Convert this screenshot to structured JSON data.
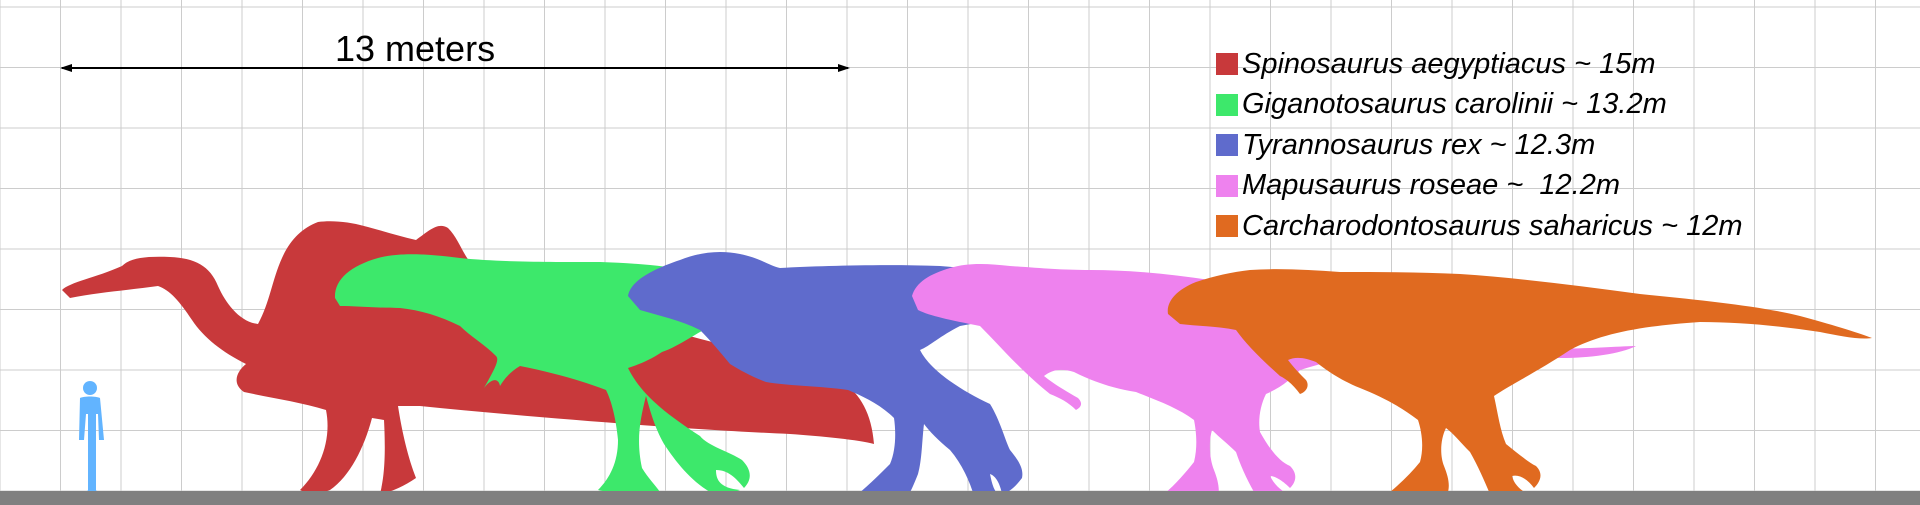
{
  "scale_bar": {
    "label": "13 meters"
  },
  "legend": [
    {
      "label": "Spinosaurus aegyptiacus ~ 15m",
      "color": "#c8393b"
    },
    {
      "label": "Giganotosaurus carolinii ~ 13.2m",
      "color": "#3de86b"
    },
    {
      "label": "Tyrannosaurus rex ~ 12.3m",
      "color": "#5f6bcc"
    },
    {
      "label": "Mapusaurus roseae ~  12.2m",
      "color": "#ee82ee"
    },
    {
      "label": "Carcharodontosaurus saharicus ~ 12m",
      "color": "#e06a20"
    }
  ],
  "human": {
    "name": "human-silhouette",
    "color": "#62b4ff"
  },
  "grid": {
    "on": true
  },
  "ground": {
    "color": "#808080"
  }
}
